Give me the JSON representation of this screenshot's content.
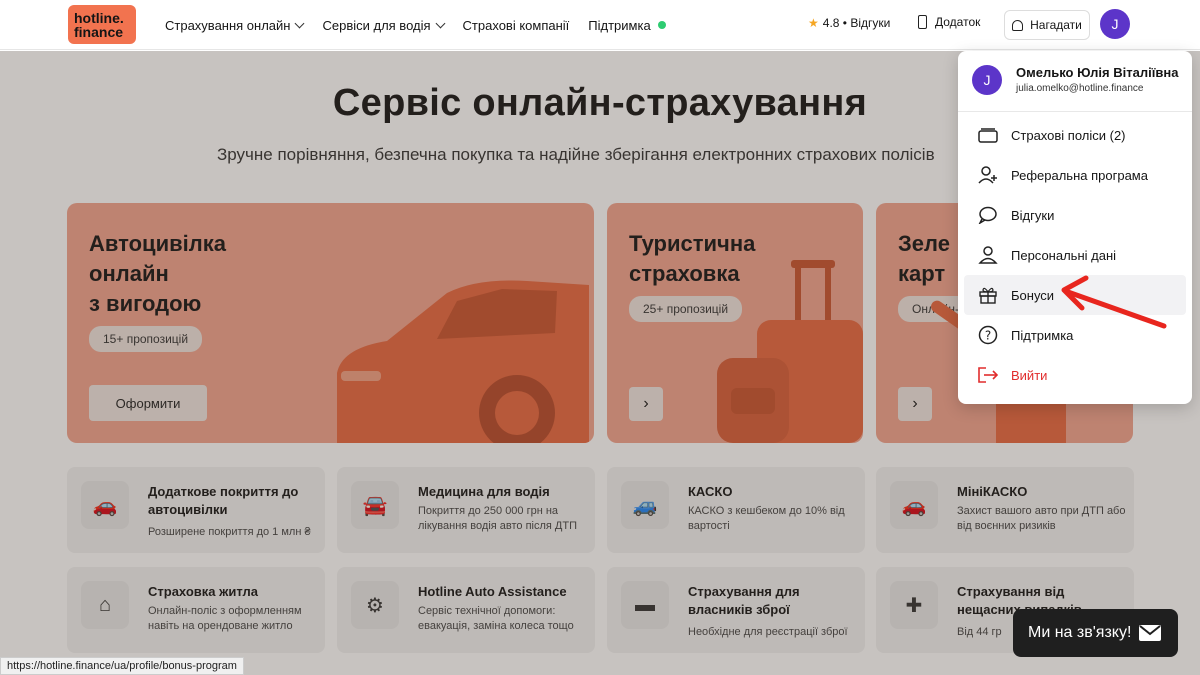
{
  "header": {
    "logo_line1": "hotline.",
    "logo_line2": "finance",
    "nav": [
      {
        "label": "Страхування онлайн"
      },
      {
        "label": "Сервіси для водія"
      },
      {
        "label": "Страхові компанії"
      },
      {
        "label": "Підтримка"
      }
    ],
    "rating": "4.8 • Відгуки",
    "app": "Додаток",
    "remind": "Нагадати",
    "avatar_letter": "J"
  },
  "hero": {
    "title": "Сервіс онлайн-страхування",
    "subtitle": "Зручне порівняння, безпечна покупка та надійне зберігання електронних страхових полісів"
  },
  "cards": [
    {
      "title_l1": "Автоцивілка",
      "title_l2": "онлайн",
      "title_l3": "з вигодою",
      "pill": "15+ пропозицій",
      "button": "Оформити"
    },
    {
      "title_l1": "Туристична",
      "title_l2": "страховка",
      "pill": "25+ пропозицій",
      "button": "›"
    },
    {
      "title_l1": "Зеле",
      "title_l2": "карт",
      "pill": "Онлайн-",
      "button": "›"
    }
  ],
  "services": [
    {
      "title": "Додаткове покриття до автоцивілки",
      "desc": "Розширене покриття до 1 млн ₴"
    },
    {
      "title": "Медицина для водія",
      "desc": "Покриття до 250 000 грн на лікування водія авто після ДТП"
    },
    {
      "title": "КАСКО",
      "desc": "КАСКО з кешбеком до 10% від вартості"
    },
    {
      "title": "МініКАСКО",
      "desc": "Захист вашого авто при ДТП або від воєнних ризиків"
    },
    {
      "title": "Страховка житла",
      "desc": "Онлайн-поліс з оформленням навіть на орендоване житло"
    },
    {
      "title": "Hotline Auto Assistance",
      "desc": "Сервіс технічної допомоги: евакуація, заміна колеса тощо"
    },
    {
      "title": "Страхування для власників зброї",
      "desc": "Необхідне для реєстрації зброї"
    },
    {
      "title": "Страхування від нещасних випадків",
      "desc": "Від 44 гр"
    }
  ],
  "dropdown": {
    "avatar_letter": "J",
    "name": "Омелько Юлія Віталіївна",
    "email": "julia.omelko@hotline.finance",
    "items": [
      {
        "label": "Страхові поліси (2)"
      },
      {
        "label": "Реферальна програма"
      },
      {
        "label": "Відгуки"
      },
      {
        "label": "Персональні дані"
      },
      {
        "label": "Бонуси"
      },
      {
        "label": "Підтримка"
      },
      {
        "label": "Вийти"
      }
    ]
  },
  "chat": {
    "label": "Ми на зв'язку!"
  },
  "status_url": "https://hotline.finance/ua/profile/bonus-program",
  "colors": {
    "brand": "#f2734f",
    "accent": "#5c35c9",
    "logout": "#e12d2d",
    "annotation": "#e8261e"
  }
}
